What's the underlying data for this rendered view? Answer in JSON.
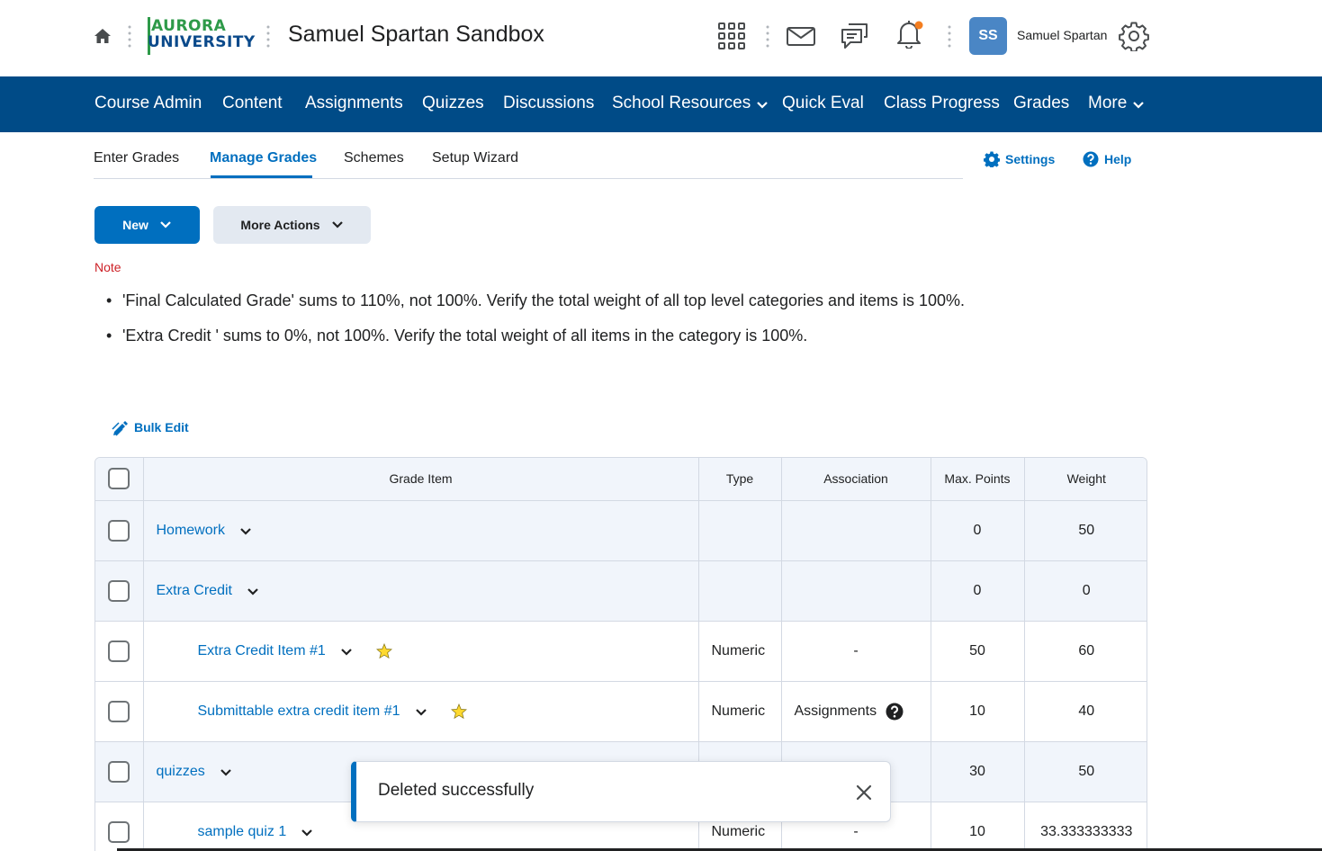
{
  "header": {
    "logo_line1": "AURORA",
    "logo_line2": "UNIVERSITY",
    "course_title": "Samuel Spartan Sandbox",
    "user_initials": "SS",
    "user_name": "Samuel Spartan",
    "icons": [
      "home-icon",
      "app-grid-icon",
      "mail-icon",
      "chat-icon",
      "bell-icon",
      "gear-icon"
    ],
    "colors": {
      "logo_green": "#2e9a49",
      "logo_blue": "#0b4a8b",
      "avatar": "#4a86c5",
      "notification_dot": "#f47e20"
    }
  },
  "navbar": {
    "background": "#004b87",
    "items": [
      {
        "label": "Course Admin",
        "dropdown": false
      },
      {
        "label": "Content",
        "dropdown": false
      },
      {
        "label": "Assignments",
        "dropdown": false
      },
      {
        "label": "Quizzes",
        "dropdown": false
      },
      {
        "label": "Discussions",
        "dropdown": false
      },
      {
        "label": "School Resources",
        "dropdown": true
      },
      {
        "label": "Quick Eval",
        "dropdown": false
      },
      {
        "label": "Class Progress",
        "dropdown": false
      },
      {
        "label": "Grades",
        "dropdown": false
      },
      {
        "label": "More",
        "dropdown": true
      }
    ]
  },
  "subtabs": {
    "items": [
      {
        "label": "Enter Grades",
        "active": false
      },
      {
        "label": "Manage Grades",
        "active": true
      },
      {
        "label": "Schemes",
        "active": false
      },
      {
        "label": "Setup Wizard",
        "active": false
      }
    ],
    "settings_label": "Settings",
    "help_label": "Help"
  },
  "actions": {
    "new_label": "New",
    "more_actions_label": "More Actions",
    "bulk_edit_label": "Bulk Edit"
  },
  "note": {
    "label": "Note",
    "items": [
      "'Final Calculated Grade' sums to 110%, not 100%. Verify the total weight of all top level categories and items is 100%.",
      "'Extra Credit ' sums to 0%, not 100%. Verify the total weight of all items in the category is 100%."
    ]
  },
  "table": {
    "columns": [
      "Grade Item",
      "Type",
      "Association",
      "Max. Points",
      "Weight"
    ],
    "rows": [
      {
        "name": "Homework",
        "category": true,
        "child": false,
        "bonus": false,
        "type": "",
        "association": "",
        "max_points": "0",
        "weight": "50"
      },
      {
        "name": "Extra Credit",
        "category": true,
        "child": false,
        "bonus": false,
        "type": "",
        "association": "",
        "max_points": "0",
        "weight": "0"
      },
      {
        "name": "Extra Credit Item #1",
        "category": false,
        "child": true,
        "bonus": true,
        "type": "Numeric",
        "association": "-",
        "max_points": "50",
        "weight": "60"
      },
      {
        "name": "Submittable extra credit item #1",
        "category": false,
        "child": true,
        "bonus": true,
        "type": "Numeric",
        "association": "Assignments",
        "association_help": true,
        "max_points": "10",
        "weight": "40"
      },
      {
        "name": "quizzes",
        "category": true,
        "child": false,
        "bonus": false,
        "type": "",
        "association": "",
        "max_points": "30",
        "weight": "50"
      },
      {
        "name": "sample quiz 1",
        "category": false,
        "child": true,
        "bonus": false,
        "type": "Numeric",
        "association": "-",
        "max_points": "10",
        "weight": "33.333333333"
      }
    ]
  },
  "toast": {
    "message": "Deleted successfully"
  }
}
